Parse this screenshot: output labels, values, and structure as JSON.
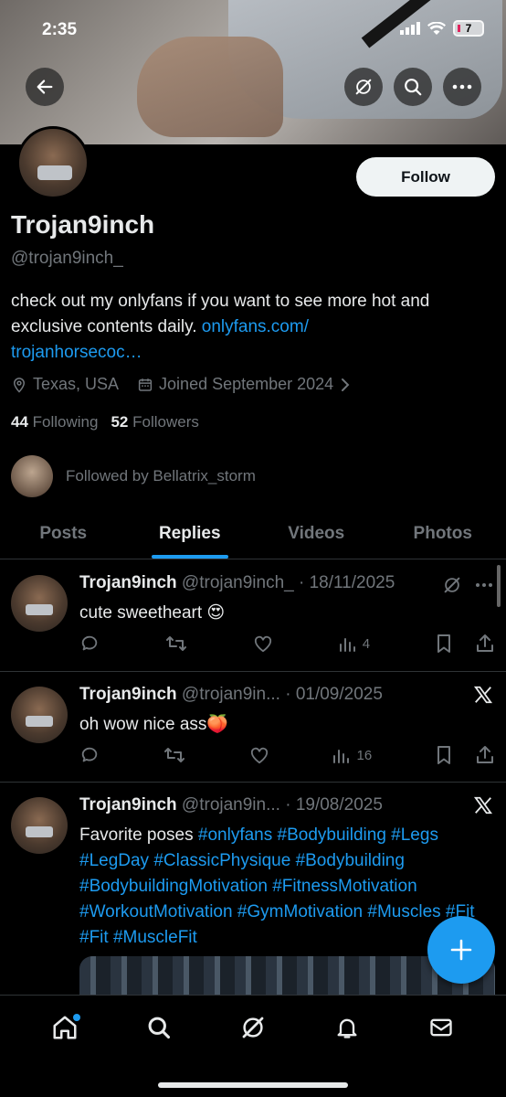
{
  "status": {
    "time": "2:35",
    "battery": "7"
  },
  "profile": {
    "display_name": "Trojan9inch",
    "handle": "@trojan9inch_",
    "bio_text": "check out my onlyfans if you want to see more hot and exclusive contents daily. ",
    "bio_link": "onlyfans.com/\ntrojanhorsecoc…",
    "location": "Texas, USA",
    "joined": "Joined September 2024",
    "following_count": "44",
    "following_label": "Following",
    "followers_count": "52",
    "followers_label": "Followers",
    "followed_by": "Followed by Bellatrix_storm",
    "follow_label": "Follow"
  },
  "tabs": [
    {
      "label": "Posts",
      "active": false
    },
    {
      "label": "Replies",
      "active": true
    },
    {
      "label": "Videos",
      "active": false
    },
    {
      "label": "Photos",
      "active": false
    }
  ],
  "posts": [
    {
      "name": "Trojan9inch",
      "handle_date": "@trojan9inch_ · 18/11/2025",
      "text": "cute sweetheart 😍",
      "views": "4",
      "source_icon": "grok-icon"
    },
    {
      "name": "Trojan9inch",
      "handle_date": "@trojan9in... · 01/09/2025",
      "text": "oh wow nice ass🍑",
      "views": "16",
      "source_icon": "x-logo-icon"
    },
    {
      "name": "Trojan9inch",
      "handle_date": "@trojan9in... · 19/08/2025",
      "text_plain": "Favorite poses ",
      "hashtags": "#onlyfans #Bodybuilding #Legs #LegDay #ClassicPhysique #Bodybuilding #BodybuildingMotivation #FitnessMotivation #WorkoutMotivation  #GymMotivation #Muscles #Fit #Fit #MuscleFit",
      "source_icon": "x-logo-icon"
    }
  ],
  "colors": {
    "accent": "#1d9bf0",
    "text": "#e7e9ea",
    "muted": "#71767b",
    "background": "#000000"
  }
}
